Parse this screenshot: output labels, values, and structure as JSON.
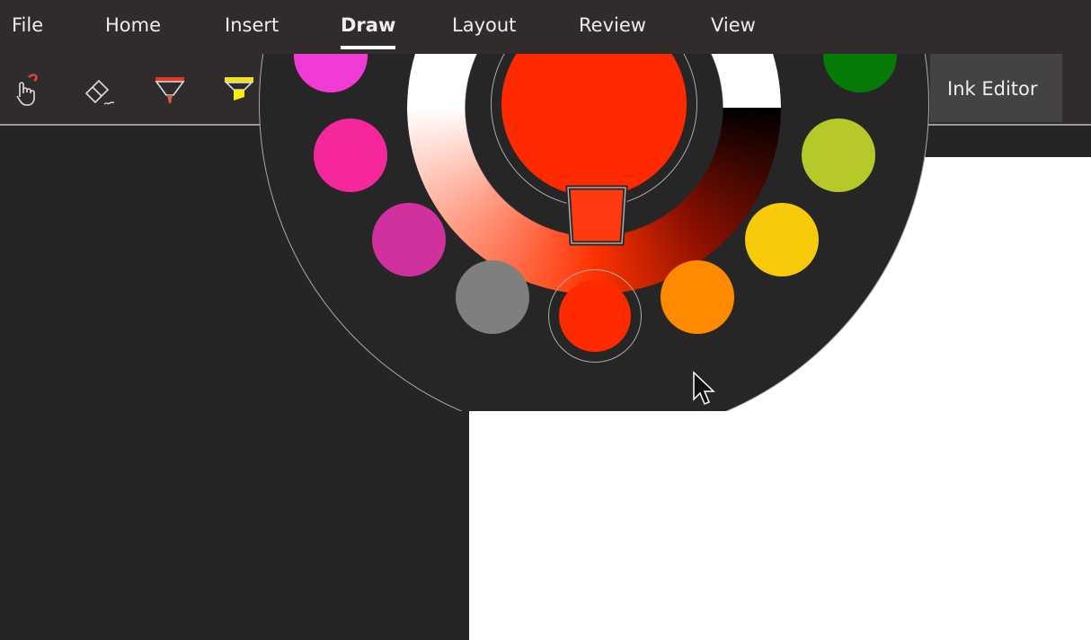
{
  "tabs": [
    {
      "label": "File"
    },
    {
      "label": "Home"
    },
    {
      "label": "Insert"
    },
    {
      "label": "Draw",
      "active": true
    },
    {
      "label": "Layout"
    },
    {
      "label": "Review"
    },
    {
      "label": "View"
    }
  ],
  "ribbon": {
    "ink_editor_label": "Ink Editor",
    "tools": [
      "touch-draw-icon",
      "eraser-icon",
      "red-pen-icon",
      "yellow-highlighter-icon"
    ]
  },
  "color_wheel": {
    "selected_color": "#ff2a00",
    "swatches": [
      "#f23bd4",
      "#f5279a",
      "#d1319f",
      "#7f7f7f",
      "#ff2a00",
      "#ff8a00",
      "#f7cb0a",
      "#b7c829",
      "#067a06"
    ]
  }
}
